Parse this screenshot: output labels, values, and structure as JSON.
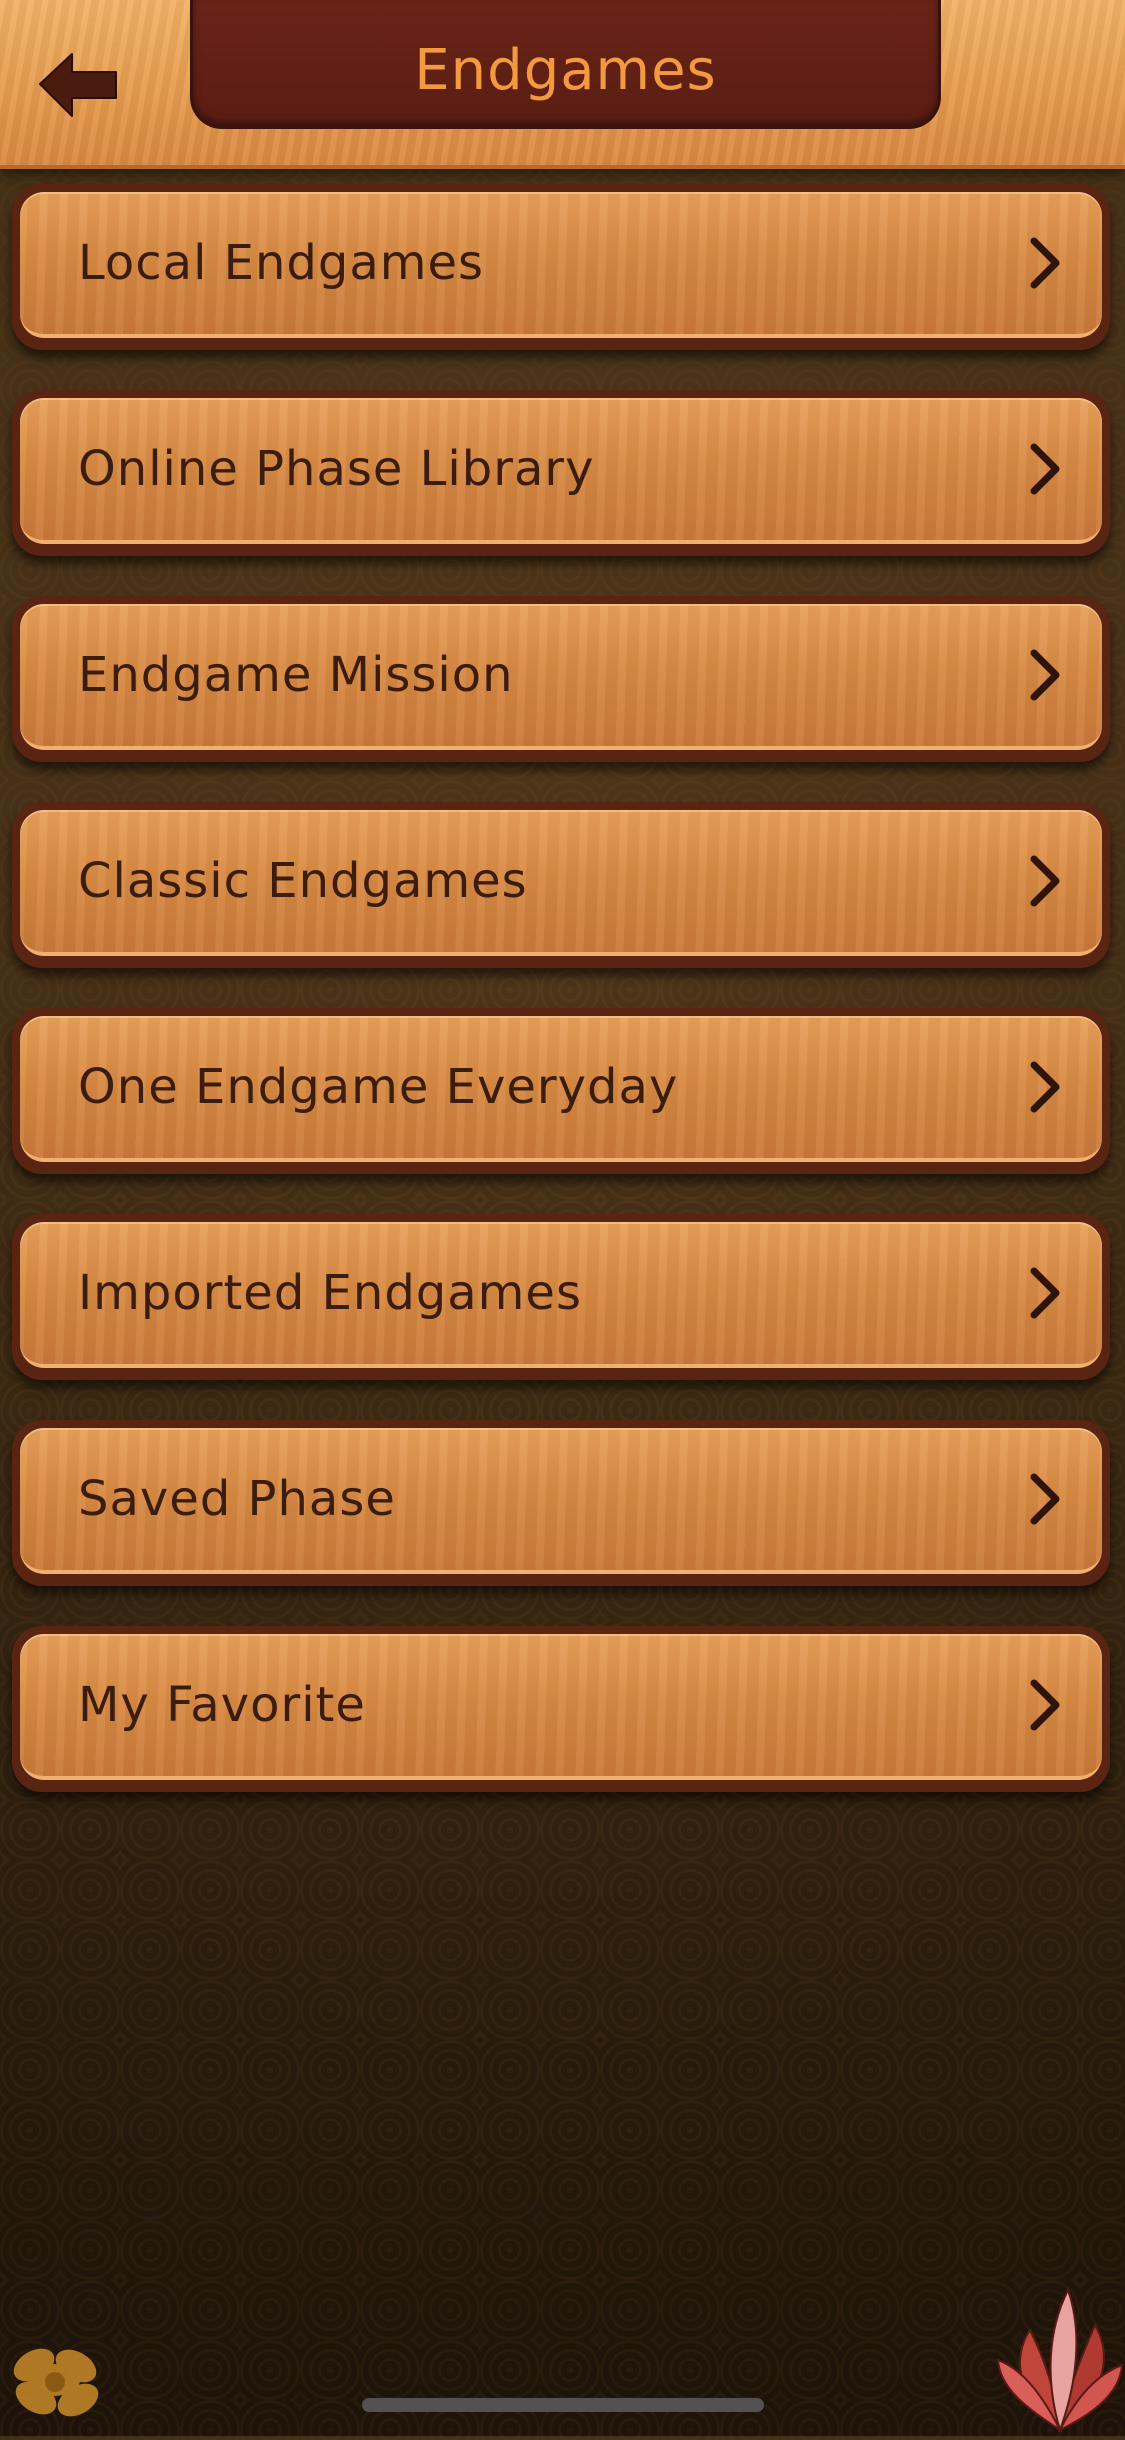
{
  "header": {
    "title": "Endgames",
    "back_icon": "back-arrow-icon"
  },
  "menu": {
    "items": [
      {
        "label": "Local Endgames",
        "icon": "chevron-right-icon"
      },
      {
        "label": "Online Phase Library",
        "icon": "chevron-right-icon"
      },
      {
        "label": "Endgame Mission",
        "icon": "chevron-right-icon"
      },
      {
        "label": "Classic Endgames",
        "icon": "chevron-right-icon"
      },
      {
        "label": "One Endgame Everyday",
        "icon": "chevron-right-icon"
      },
      {
        "label": "Imported Endgames",
        "icon": "chevron-right-icon"
      },
      {
        "label": "Saved Phase",
        "icon": "chevron-right-icon"
      },
      {
        "label": "My Favorite",
        "icon": "chevron-right-icon"
      }
    ]
  },
  "colors": {
    "header_wood": "#e59a4d",
    "title_plate": "#5a1d12",
    "title_text": "#f3993f",
    "button_wood": "#d88a43",
    "button_text": "#3b1d10",
    "background": "#4d351a"
  }
}
